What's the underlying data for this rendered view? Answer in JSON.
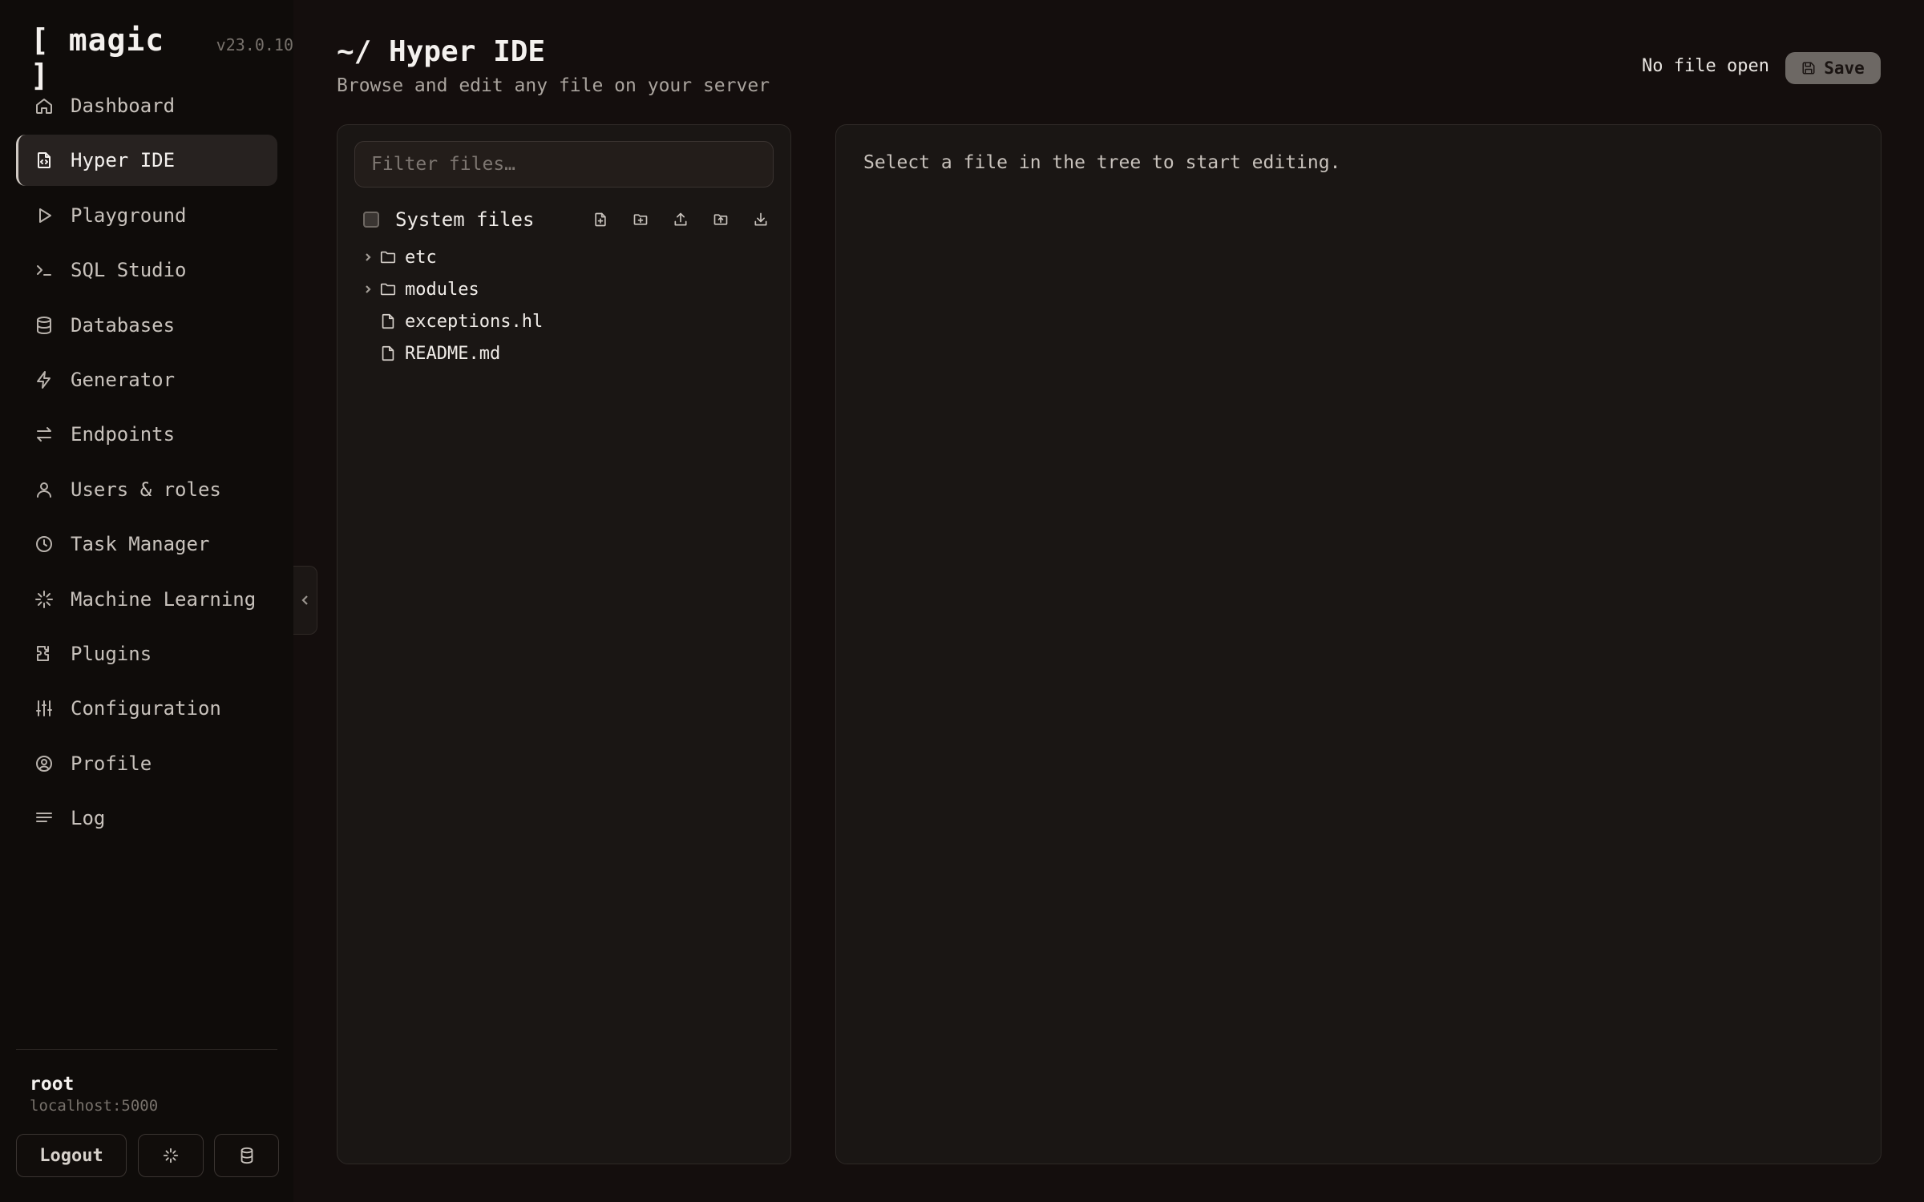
{
  "brand": {
    "name": "[ magic ]",
    "version": "v23.0.10"
  },
  "nav": [
    {
      "label": "Dashboard",
      "icon": "home-icon"
    },
    {
      "label": "Hyper IDE",
      "icon": "file-code-icon",
      "active": true
    },
    {
      "label": "Playground",
      "icon": "play-icon"
    },
    {
      "label": "SQL Studio",
      "icon": "terminal-icon"
    },
    {
      "label": "Databases",
      "icon": "database-icon"
    },
    {
      "label": "Generator",
      "icon": "lightning-icon"
    },
    {
      "label": "Endpoints",
      "icon": "arrows-icon"
    },
    {
      "label": "Users & roles",
      "icon": "user-icon"
    },
    {
      "label": "Task Manager",
      "icon": "clock-icon"
    },
    {
      "label": "Machine Learning",
      "icon": "sparkle-icon"
    },
    {
      "label": "Plugins",
      "icon": "puzzle-icon"
    },
    {
      "label": "Configuration",
      "icon": "sliders-icon"
    },
    {
      "label": "Profile",
      "icon": "user-circle-icon"
    },
    {
      "label": "Log",
      "icon": "lines-icon"
    }
  ],
  "user": {
    "name": "root",
    "host": "localhost:5000"
  },
  "sidebar_buttons": {
    "logout": "Logout"
  },
  "header": {
    "title": "~/ Hyper IDE",
    "subtitle": "Browse and edit any file on your server",
    "file_status": "No file open",
    "save_label": "Save"
  },
  "tree": {
    "filter_placeholder": "Filter files…",
    "system_files_label": "System files",
    "system_files_checked": false,
    "nodes": [
      {
        "name": "etc",
        "type": "folder"
      },
      {
        "name": "modules",
        "type": "folder"
      },
      {
        "name": "exceptions.hl",
        "type": "file"
      },
      {
        "name": "README.md",
        "type": "file"
      }
    ]
  },
  "editor": {
    "empty_text": "Select a file in the tree to start editing."
  },
  "colors": {
    "background": "#140e0d",
    "sidebar": "#0f0c0a",
    "panel": "#1a1614",
    "accent": "#6d6864"
  }
}
